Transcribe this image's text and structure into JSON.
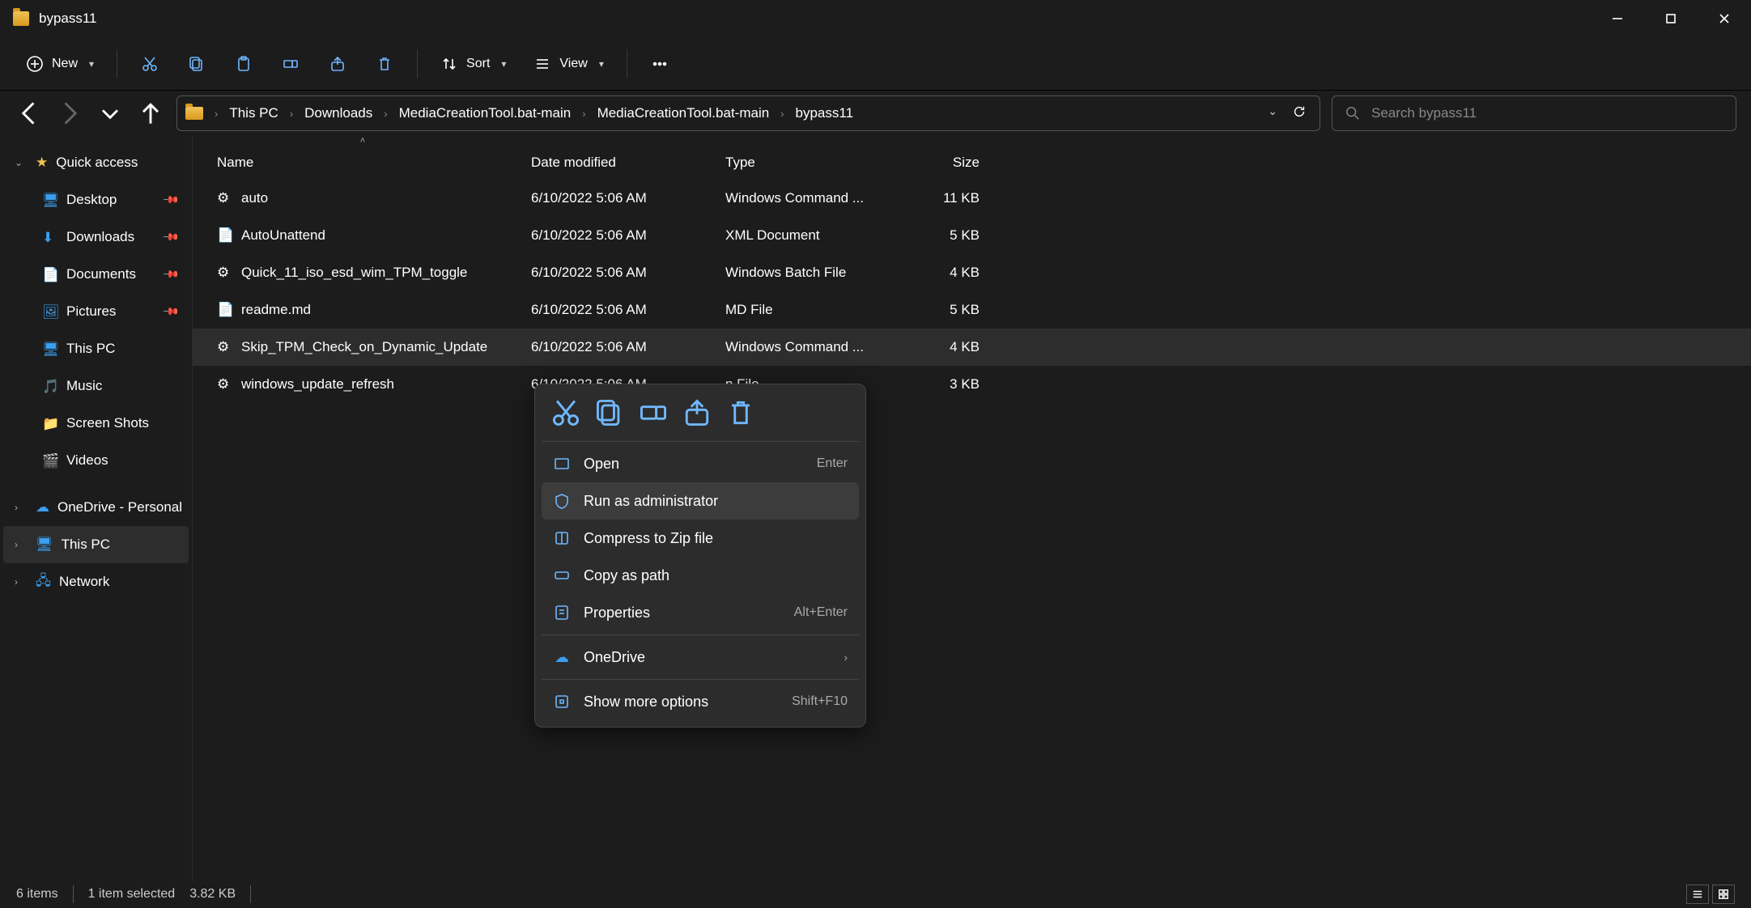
{
  "window": {
    "title": "bypass11"
  },
  "toolbar": {
    "new": "New",
    "sort": "Sort",
    "view": "View"
  },
  "breadcrumb": [
    "This PC",
    "Downloads",
    "MediaCreationTool.bat-main",
    "MediaCreationTool.bat-main",
    "bypass11"
  ],
  "search": {
    "placeholder": "Search bypass11"
  },
  "sidebar": {
    "quick": "Quick access",
    "items": [
      {
        "label": "Desktop",
        "icon": "desktop",
        "pinned": true
      },
      {
        "label": "Downloads",
        "icon": "downloads",
        "pinned": true
      },
      {
        "label": "Documents",
        "icon": "documents",
        "pinned": true
      },
      {
        "label": "Pictures",
        "icon": "pictures",
        "pinned": true
      },
      {
        "label": "This PC",
        "icon": "pc",
        "pinned": false
      },
      {
        "label": "Music",
        "icon": "music",
        "pinned": false
      },
      {
        "label": "Screen Shots",
        "icon": "folder",
        "pinned": false
      },
      {
        "label": "Videos",
        "icon": "videos",
        "pinned": false
      }
    ],
    "onedrive": "OneDrive - Personal",
    "thispc": "This PC",
    "network": "Network"
  },
  "columns": {
    "name": "Name",
    "date": "Date modified",
    "type": "Type",
    "size": "Size"
  },
  "files": [
    {
      "name": "auto",
      "date": "6/10/2022 5:06 AM",
      "type": "Windows Command ...",
      "size": "11 KB",
      "icon": "cmd"
    },
    {
      "name": "AutoUnattend",
      "date": "6/10/2022 5:06 AM",
      "type": "XML Document",
      "size": "5 KB",
      "icon": "xml"
    },
    {
      "name": "Quick_11_iso_esd_wim_TPM_toggle",
      "date": "6/10/2022 5:06 AM",
      "type": "Windows Batch File",
      "size": "4 KB",
      "icon": "cmd"
    },
    {
      "name": "readme.md",
      "date": "6/10/2022 5:06 AM",
      "type": "MD File",
      "size": "5 KB",
      "icon": "txt"
    },
    {
      "name": "Skip_TPM_Check_on_Dynamic_Update",
      "date": "6/10/2022 5:06 AM",
      "type": "Windows Command ...",
      "size": "4 KB",
      "icon": "cmd",
      "selected": true
    },
    {
      "name": "windows_update_refresh",
      "date": "6/10/2022 5:06 AM",
      "type": "n File",
      "size": "3 KB",
      "icon": "cmd"
    }
  ],
  "context": {
    "open": "Open",
    "open_kbd": "Enter",
    "runadmin": "Run as administrator",
    "compress": "Compress to Zip file",
    "copypath": "Copy as path",
    "properties": "Properties",
    "props_kbd": "Alt+Enter",
    "onedrive": "OneDrive",
    "more": "Show more options",
    "more_kbd": "Shift+F10"
  },
  "status": {
    "items": "6 items",
    "selected": "1 item selected",
    "size": "3.82 KB"
  }
}
